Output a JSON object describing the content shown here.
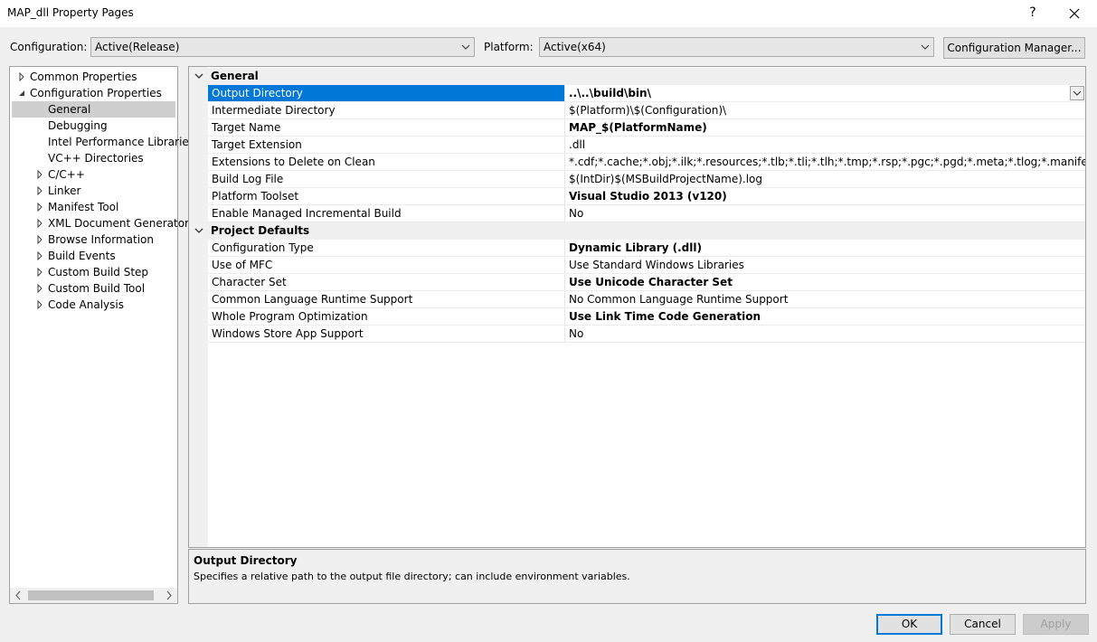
{
  "window": {
    "title": "MAP_dll Property Pages",
    "help_label": "?",
    "close_icon": "close-icon"
  },
  "config_bar": {
    "configuration_label": "Configuration:",
    "configuration_value": "Active(Release)",
    "platform_label": "Platform:",
    "platform_value": "Active(x64)",
    "manager_button": "Configuration Manager..."
  },
  "tree": [
    {
      "label": "Common Properties",
      "expander": "collapsed"
    },
    {
      "label": "Configuration Properties",
      "expander": "expanded"
    },
    {
      "label": "General",
      "expander": "none",
      "selected": true
    },
    {
      "label": "Debugging",
      "expander": "none"
    },
    {
      "label": "Intel Performance Libraries",
      "expander": "none"
    },
    {
      "label": "VC++ Directories",
      "expander": "none"
    },
    {
      "label": "C/C++",
      "expander": "collapsed"
    },
    {
      "label": "Linker",
      "expander": "collapsed"
    },
    {
      "label": "Manifest Tool",
      "expander": "collapsed"
    },
    {
      "label": "XML Document Generator",
      "expander": "collapsed"
    },
    {
      "label": "Browse Information",
      "expander": "collapsed"
    },
    {
      "label": "Build Events",
      "expander": "collapsed"
    },
    {
      "label": "Custom Build Step",
      "expander": "collapsed"
    },
    {
      "label": "Custom Build Tool",
      "expander": "collapsed"
    },
    {
      "label": "Code Analysis",
      "expander": "collapsed"
    }
  ],
  "grid": {
    "categories": [
      {
        "name": "General",
        "rows": [
          {
            "name": "Output Directory",
            "value": "..\\..\\build\\bin\\",
            "bold": true,
            "selected": true
          },
          {
            "name": "Intermediate Directory",
            "value": "$(Platform)\\$(Configuration)\\",
            "bold": false
          },
          {
            "name": "Target Name",
            "value": "MAP_$(PlatformName)",
            "bold": true
          },
          {
            "name": "Target Extension",
            "value": ".dll",
            "bold": false
          },
          {
            "name": "Extensions to Delete on Clean",
            "value": "*.cdf;*.cache;*.obj;*.ilk;*.resources;*.tlb;*.tli;*.tlh;*.tmp;*.rsp;*.pgc;*.pgd;*.meta;*.tlog;*.manifest;*.res;*.pch;*.e",
            "bold": false
          },
          {
            "name": "Build Log File",
            "value": "$(IntDir)$(MSBuildProjectName).log",
            "bold": false
          },
          {
            "name": "Platform Toolset",
            "value": "Visual Studio 2013 (v120)",
            "bold": true
          },
          {
            "name": "Enable Managed Incremental Build",
            "value": "No",
            "bold": false
          }
        ]
      },
      {
        "name": "Project Defaults",
        "rows": [
          {
            "name": "Configuration Type",
            "value": "Dynamic Library (.dll)",
            "bold": true
          },
          {
            "name": "Use of MFC",
            "value": "Use Standard Windows Libraries",
            "bold": false
          },
          {
            "name": "Character Set",
            "value": "Use Unicode Character Set",
            "bold": true
          },
          {
            "name": "Common Language Runtime Support",
            "value": "No Common Language Runtime Support",
            "bold": false
          },
          {
            "name": "Whole Program Optimization",
            "value": "Use Link Time Code Generation",
            "bold": true
          },
          {
            "name": "Windows Store App Support",
            "value": "No",
            "bold": false
          }
        ]
      }
    ]
  },
  "description": {
    "title": "Output Directory",
    "text": "Specifies a relative path to the output file directory; can include environment variables."
  },
  "buttons": {
    "ok": "OK",
    "cancel": "Cancel",
    "apply": "Apply"
  },
  "colors": {
    "selection": "#0078d7",
    "tree_selection": "#cfcfcf",
    "ok_border": "#0078d7"
  }
}
